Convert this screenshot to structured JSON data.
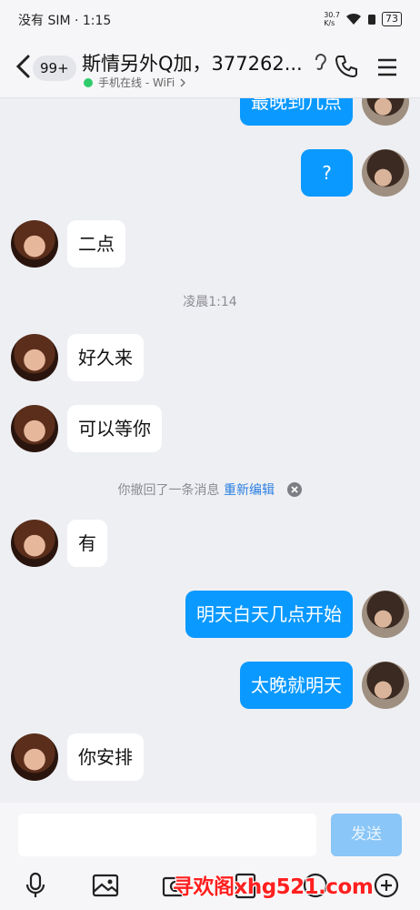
{
  "status_bar": {
    "carrier_time": "没有 SIM · 1:15",
    "net_speed": "30.7\nK/s",
    "battery": "73"
  },
  "header": {
    "unread_count": "99+",
    "title": "斯情另外Q加，377262...",
    "subtitle": "手机在线 - WiFi",
    "online_color": "#2fcb6a"
  },
  "messages": [
    {
      "side": "out",
      "text": "最晚到几点"
    },
    {
      "side": "out",
      "text": "?"
    },
    {
      "side": "in",
      "text": "二点"
    },
    {
      "side": "in",
      "text": "好久来"
    },
    {
      "side": "in",
      "text": "可以等你"
    },
    {
      "side": "in",
      "text": "有"
    },
    {
      "side": "out",
      "text": "明天白天几点开始"
    },
    {
      "side": "out",
      "text": "太晚就明天"
    },
    {
      "side": "in",
      "text": "你安排"
    }
  ],
  "system": {
    "timestamp": "凌晨1:14",
    "recall_text": "你撤回了一条消息",
    "reedit_link": "重新编辑"
  },
  "composer": {
    "input_value": "",
    "send_label": "发送",
    "accent": "#0a99ff"
  },
  "toolbar_icons": [
    "microphone-icon",
    "image-icon",
    "camera-icon",
    "red-packet-icon",
    "emoji-icon",
    "plus-icon"
  ],
  "watermark": "寻欢阁xhg521.com"
}
